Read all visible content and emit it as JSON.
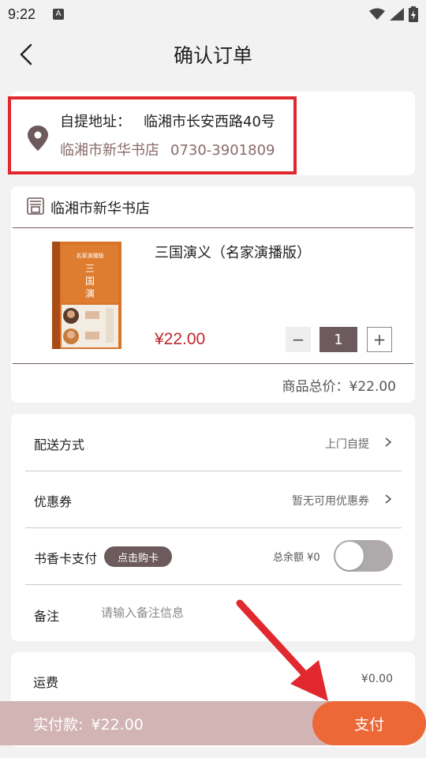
{
  "status_bar": {
    "time": "9:22",
    "icons": [
      "notification-a-icon",
      "wifi-icon",
      "signal-icon",
      "battery-icon"
    ]
  },
  "header": {
    "title": "确认订单",
    "back_icon": "back-arrow-icon"
  },
  "pickup": {
    "address_label": "自提地址：",
    "address": "临湘市长安西路40号",
    "store": "临湘市新华书店",
    "phone": "0730-3901809",
    "icon": "location-pin-icon"
  },
  "store": {
    "name": "临湘市新华书店",
    "icon": "store-icon",
    "product": {
      "name": "三国演义（名家演播版）",
      "price": "¥22.00",
      "quantity": "1",
      "minus": "−",
      "plus": "+"
    },
    "total": "商品总价：¥22.00"
  },
  "options": {
    "delivery": {
      "label": "配送方式",
      "value": "上门自提"
    },
    "coupon": {
      "label": "优惠券",
      "value": "暂无可用优惠券"
    },
    "card_pay": {
      "label": "书香卡支付",
      "buy_button": "点击购卡",
      "balance": "总余额 ¥0",
      "toggle_on": false
    },
    "remark": {
      "label": "备注",
      "placeholder": "请输入备注信息"
    },
    "arrow": ">"
  },
  "shipping": {
    "label": "运费",
    "value": "¥0.00"
  },
  "pay_bar": {
    "label": "实付款:",
    "amount": "¥22.00",
    "button": "支付"
  },
  "colors": {
    "accent": "#6d5a5c",
    "price_red": "#c1272d",
    "pay_button": "#ec6837",
    "pay_bar": "#d3b4b4",
    "highlight_red": "#e0282e"
  }
}
